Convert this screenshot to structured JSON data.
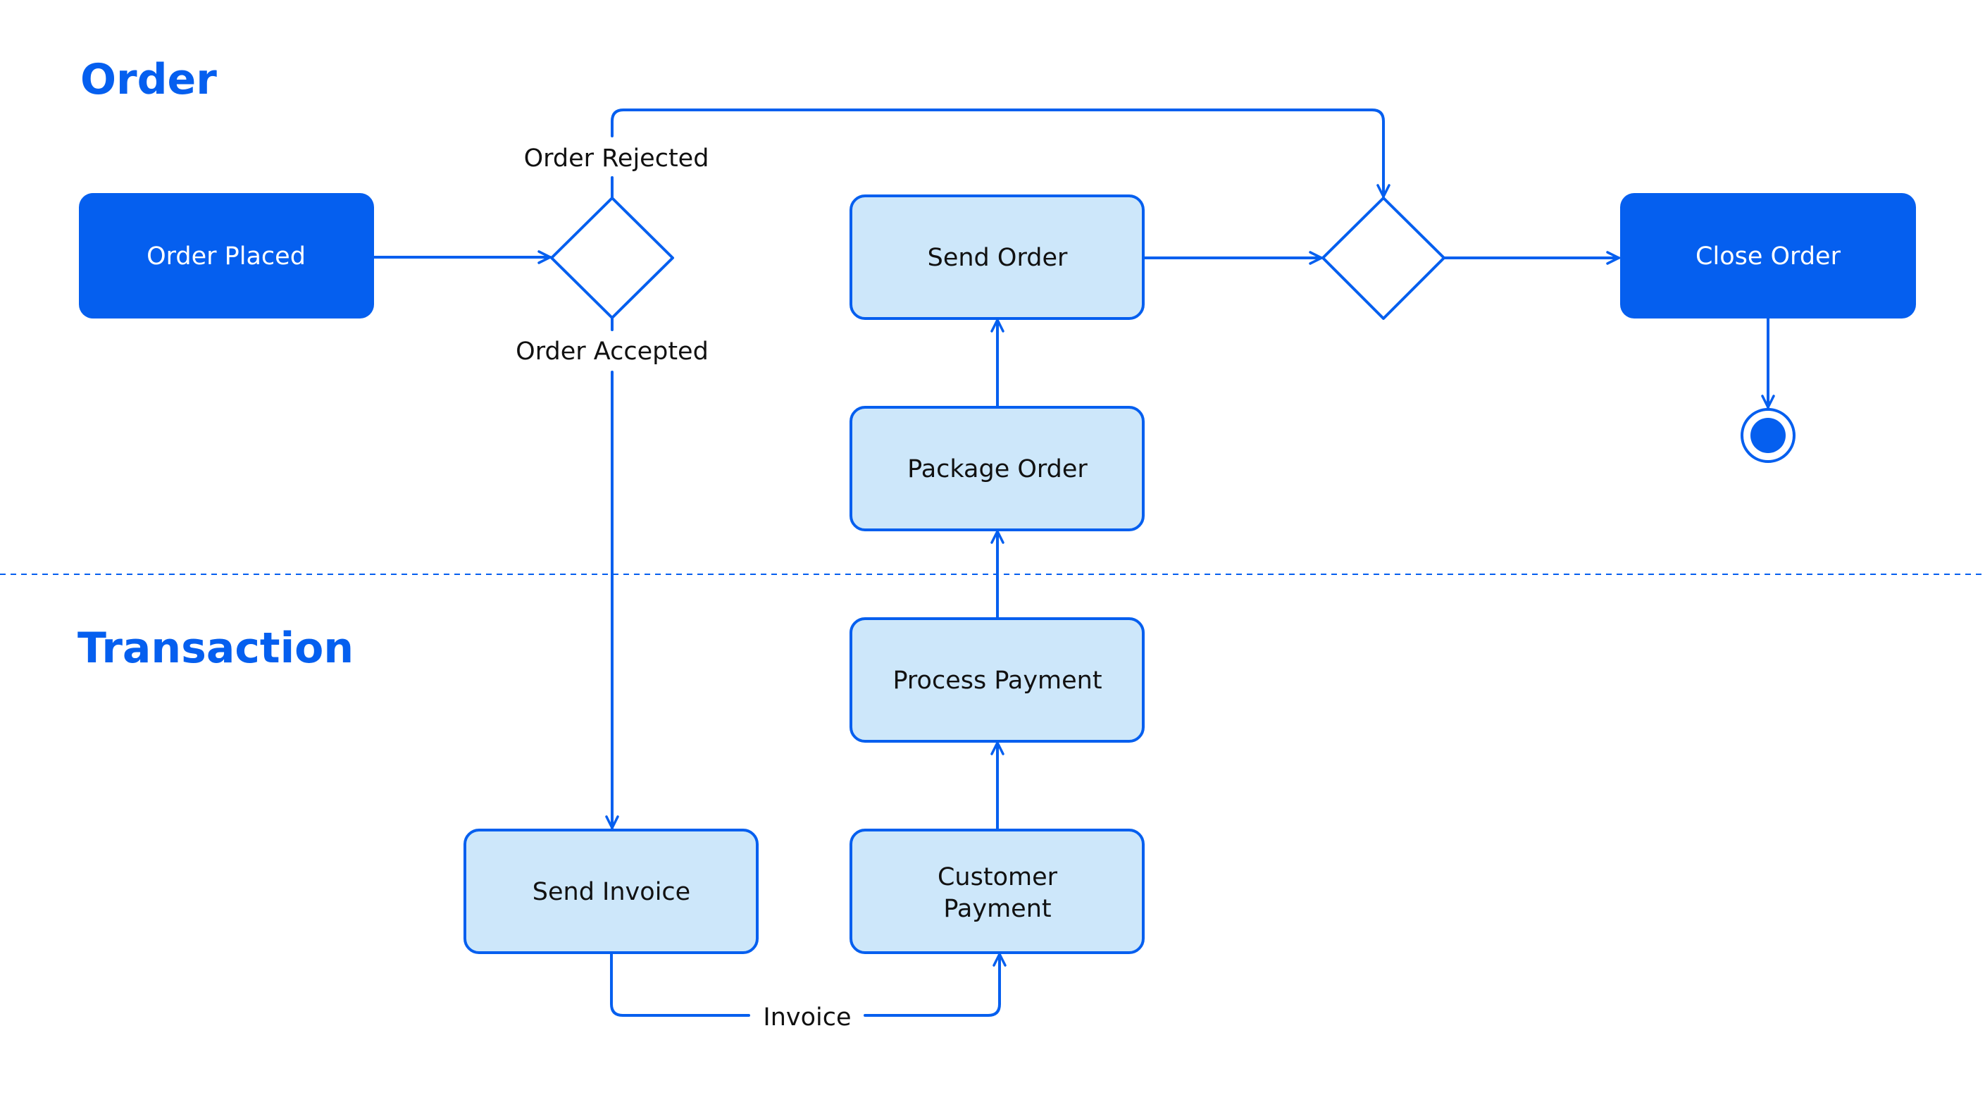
{
  "colors": {
    "accent": "#055FEF",
    "activity_fill": "#CDE7FA",
    "terminal_fill": "#055FEF",
    "text_dark": "#111111",
    "text_light": "#FFFFFF",
    "divider": "#055FEF"
  },
  "lanes": [
    {
      "id": "order",
      "title": "Order"
    },
    {
      "id": "transaction",
      "title": "Transaction"
    }
  ],
  "nodes": {
    "order_placed": {
      "label": "Order Placed",
      "kind": "terminal-action"
    },
    "decision_accept": {
      "label": "",
      "kind": "decision"
    },
    "send_order": {
      "label": "Send Order",
      "kind": "activity"
    },
    "merge": {
      "label": "",
      "kind": "decision"
    },
    "close_order": {
      "label": "Close Order",
      "kind": "terminal-action"
    },
    "end": {
      "label": "",
      "kind": "final-node"
    },
    "package_order": {
      "label": "Package Order",
      "kind": "activity"
    },
    "process_payment": {
      "label": "Process Payment",
      "kind": "activity"
    },
    "send_invoice": {
      "label": "Send Invoice",
      "kind": "activity"
    },
    "customer_payment": {
      "label_line1": "Customer",
      "label_line2": "Payment",
      "kind": "activity"
    }
  },
  "edges": [
    {
      "from": "order_placed",
      "to": "decision_accept",
      "label": ""
    },
    {
      "from": "decision_accept",
      "to": "merge",
      "label": "Order Rejected"
    },
    {
      "from": "decision_accept",
      "to": "send_invoice",
      "label": "Order Accepted"
    },
    {
      "from": "send_invoice",
      "to": "customer_payment",
      "label": "Invoice"
    },
    {
      "from": "customer_payment",
      "to": "process_payment",
      "label": ""
    },
    {
      "from": "process_payment",
      "to": "package_order",
      "label": ""
    },
    {
      "from": "package_order",
      "to": "send_order",
      "label": ""
    },
    {
      "from": "send_order",
      "to": "merge",
      "label": ""
    },
    {
      "from": "merge",
      "to": "close_order",
      "label": ""
    },
    {
      "from": "close_order",
      "to": "end",
      "label": ""
    }
  ]
}
